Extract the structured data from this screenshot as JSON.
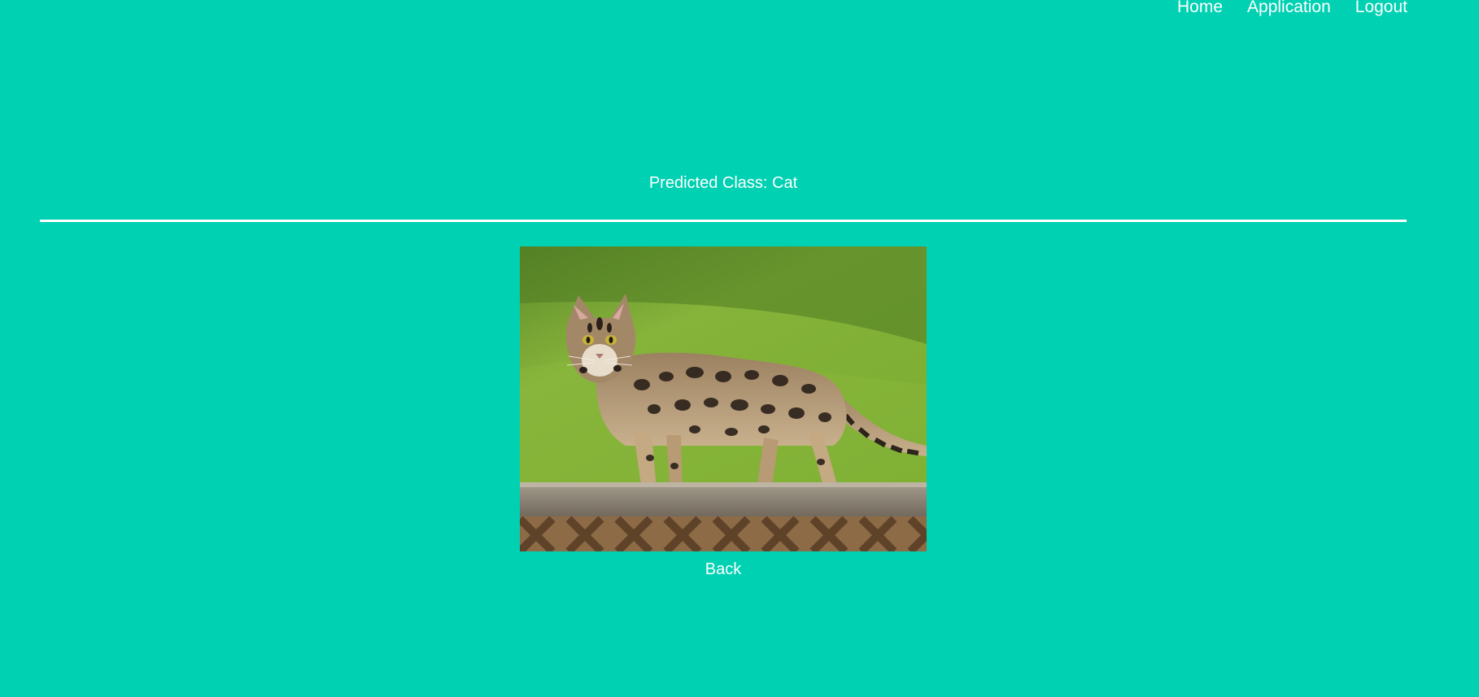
{
  "nav": {
    "items": [
      {
        "label": "Home"
      },
      {
        "label": "Application"
      },
      {
        "label": "Logout"
      }
    ]
  },
  "result": {
    "text": "Predicted Class: Cat"
  },
  "image": {
    "subject": "cat-photo"
  },
  "back_label": "Back",
  "colors": {
    "background": "#00d1b2",
    "text": "#ffffff"
  }
}
